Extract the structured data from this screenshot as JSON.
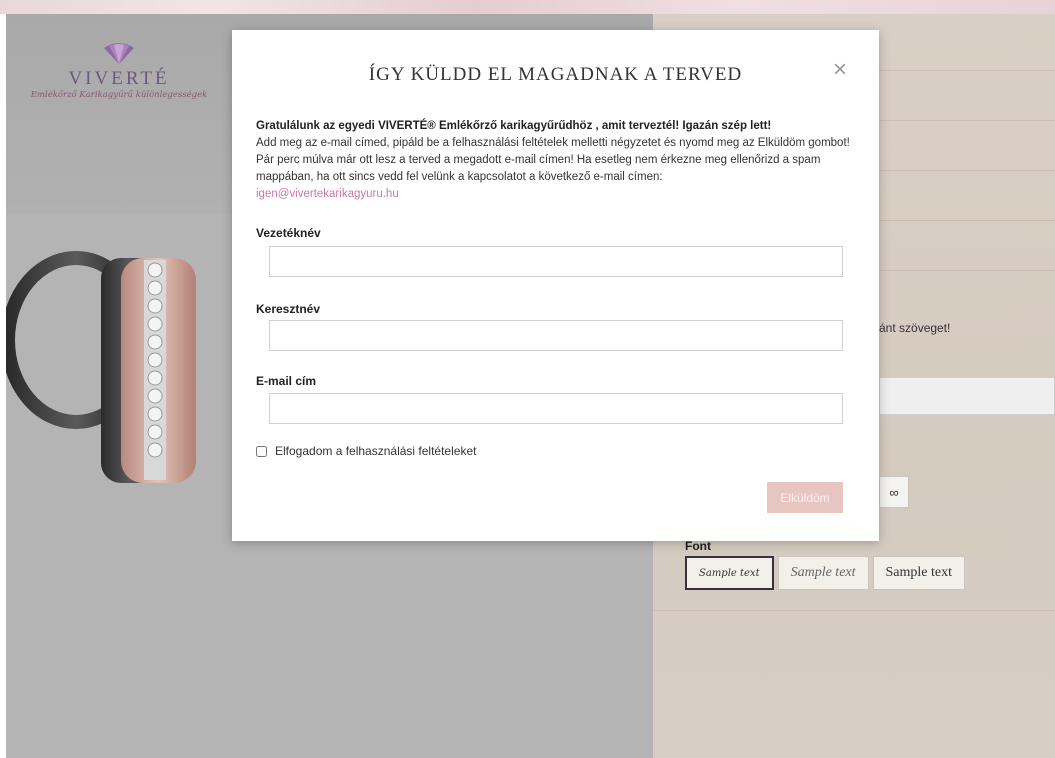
{
  "logo": {
    "name": "VIVERTÉ",
    "tagline": "Emlékőrző Karikagyűrű különlegességek"
  },
  "background": {
    "partial_text": "ánt szöveget!",
    "symbol_button": "∞",
    "font_label": "Font",
    "font_options": [
      "Sample text",
      "Sample text",
      "Sample text"
    ]
  },
  "modal": {
    "title": "ÍGY KÜLDD EL MAGADNAK A TERVED",
    "close_symbol": "×",
    "intro_lead": "Gratulálunk az egyedi VIVERTÉ® Emlékőrző karikagyűrűdhöz , amit terveztél! Igazán szép lett!",
    "intro_text": "Add meg az e-mail címed, pipáld be a felhasználási feltételek melletti négyzetet és nyomd meg az Elküldöm gombot! Pár perc múlva már ott lesz a terved a megadott e-mail címen! Ha esetleg nem érkezne meg ellenőrizd a spam mappában, ha ott sincs vedd fel velünk a kapcsolatot a következő e-mail címen:",
    "contact_email": "igen@vivertekarikagyuru.hu",
    "fields": {
      "lastname_label": "Vezetéknév",
      "lastname_value": "",
      "firstname_label": "Keresztnév",
      "firstname_value": "",
      "email_label": "E-mail cím",
      "email_value": ""
    },
    "terms_label": "Elfogadom a felhasználási feltételeket",
    "terms_checked": false,
    "submit_label": "Elküldöm"
  },
  "colors": {
    "accent_link": "#c77aa6",
    "submit_button": "#e7c5c0",
    "brand_purple": "#6c5a7a"
  }
}
